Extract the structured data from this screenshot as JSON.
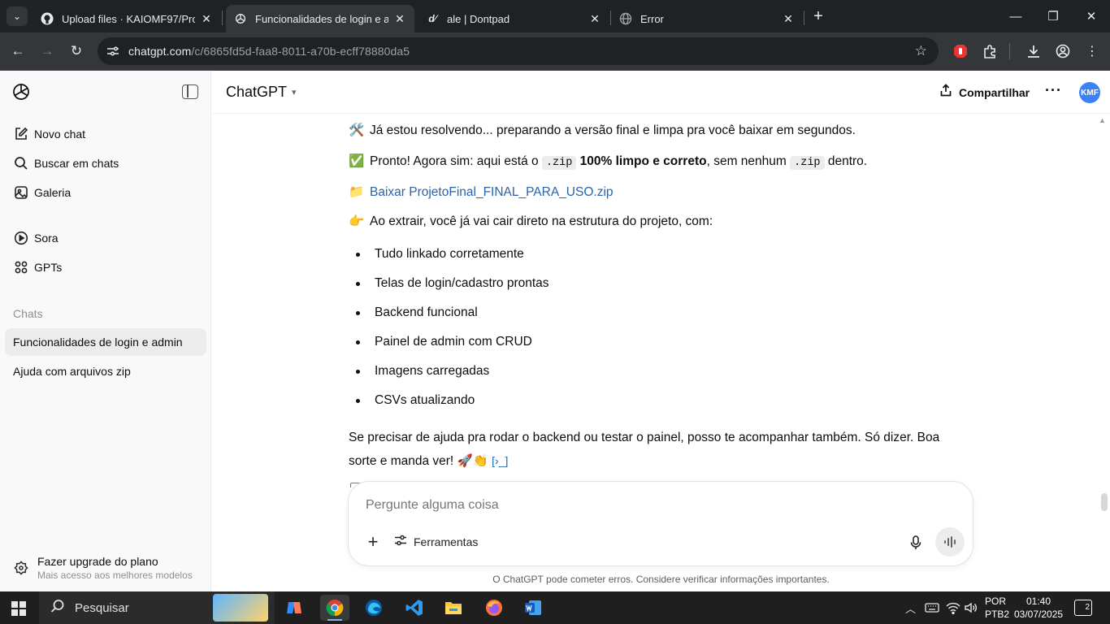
{
  "browser": {
    "tabs": [
      {
        "title": "Upload files · KAIOMF97/Projeto",
        "favicon": "github-icon",
        "active": false
      },
      {
        "title": "Funcionalidades de login e admin",
        "favicon": "openai-icon",
        "active": true
      },
      {
        "title": "ale | Dontpad",
        "favicon": "dontpad-icon",
        "active": false
      },
      {
        "title": "Error",
        "favicon": "globe-icon",
        "active": false
      }
    ],
    "address_host": "chatgpt.com",
    "address_path": "/c/6865fd5d-faa8-8011-a70b-ecff78880da5"
  },
  "sidebar": {
    "nav": [
      {
        "label": "Novo chat",
        "icon": "new-chat-icon"
      },
      {
        "label": "Buscar em chats",
        "icon": "search-icon"
      },
      {
        "label": "Galeria",
        "icon": "gallery-icon"
      },
      {
        "label": "Sora",
        "icon": "play-icon"
      },
      {
        "label": "GPTs",
        "icon": "grid-icon"
      }
    ],
    "section_label": "Chats",
    "chats": [
      {
        "label": "Funcionalidades de login e admin",
        "active": true
      },
      {
        "label": "Ajuda com arquivos zip",
        "active": false
      }
    ],
    "upgrade_title": "Fazer upgrade do plano",
    "upgrade_sub": "Mais acesso aos melhores modelos"
  },
  "header": {
    "model": "ChatGPT",
    "share_label": "Compartilhar",
    "avatar_initials": "KMF"
  },
  "message": {
    "line1_emoji": "🛠️",
    "line1": "Já estou resolvendo... preparando a versão final e limpa pra você baixar em segundos.",
    "line2_emoji": "✅",
    "line2_a": "Pronto! Agora sim: aqui está o ",
    "line2_code1": ".zip",
    "line2_bold": "100% limpo e correto",
    "line2_b": ", sem nenhum ",
    "line2_code2": ".zip",
    "line2_c": " dentro.",
    "link_emoji": "📁",
    "link_text": "Baixar ProjetoFinal_FINAL_PARA_USO.zip",
    "line3_emoji": "👉",
    "line3": "Ao extrair, você já vai cair direto na estrutura do projeto, com:",
    "bullets": [
      "Tudo linkado corretamente",
      "Telas de login/cadastro prontas",
      "Backend funcional",
      "Painel de admin com CRUD",
      "Imagens carregadas",
      "CSVs atualizando"
    ],
    "closing": "Se precisar de ajuda pra rodar o backend ou testar o painel, posso te acompanhar também. Só dizer. Boa sorte e manda ver! 🚀👏"
  },
  "composer": {
    "placeholder": "Pergunte alguma coisa",
    "tools_label": "Ferramentas"
  },
  "disclaimer": "O ChatGPT pode cometer erros. Considere verificar informações importantes.",
  "taskbar": {
    "search_label": "Pesquisar",
    "lang_line1": "POR",
    "lang_line2": "PTB2",
    "time": "01:40",
    "date": "03/07/2025",
    "notifications": "2"
  }
}
